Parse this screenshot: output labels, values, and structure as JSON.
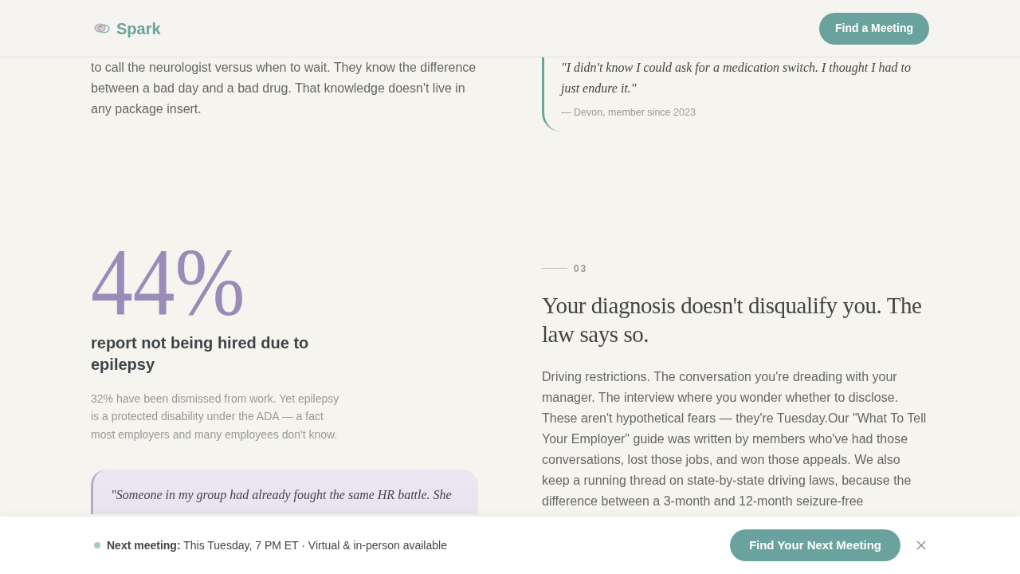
{
  "header": {
    "brand": "Spark",
    "button": "Find a Meeting"
  },
  "intro": {
    "paragraph": "to call the neurologist versus when to wait. They know the difference between a bad day and a bad drug. That knowledge doesn't live in any package insert.",
    "quote": {
      "text": "\"I didn't know I could ask for a medication switch. I thought I had to just endure it.\"",
      "attribution": "— Devon, member since 2023"
    }
  },
  "stat": {
    "value": "44%",
    "headline": "report not being hired due to epilepsy",
    "detail": "32% have been dismissed from work. Yet epilepsy is a protected disability under the ADA — a fact most employers and many employees don't know.",
    "quote": "\"Someone in my group had already fought the same HR battle. She"
  },
  "section": {
    "number": "03",
    "title": "Your diagnosis doesn't disqualify you. The law says so.",
    "body": "Driving restrictions. The conversation you're dreading with your manager. The interview where you wonder whether to disclose. These aren't hypothetical fears — they're Tuesday.Our \"What To Tell Your Employer\" guide was written by members who've had those conversations, lost those jobs, and won those appeals. We also keep a running thread on state-by-state driving laws, because the difference between a 3-month and 12-month seizure-free"
  },
  "bottom_bar": {
    "message": "**Next meeting:** This Tuesday, 7 PM ET · Virtual & in-person available",
    "button": "Find Your Next Meeting"
  }
}
